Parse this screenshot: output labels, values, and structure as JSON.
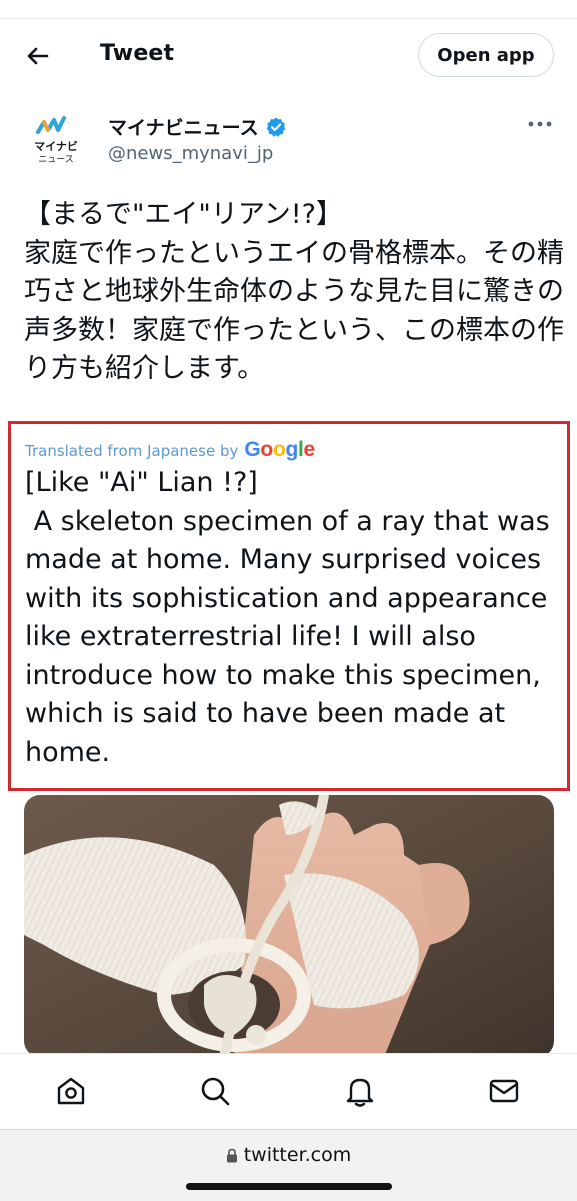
{
  "header": {
    "back_icon": "arrow-left-icon",
    "title": "Tweet",
    "open_app_label": "Open app"
  },
  "author": {
    "avatar_text_top": "マイナビ",
    "avatar_text_bottom": "ニュース",
    "name": "マイナビニュース",
    "verified_icon": "verified-badge-icon",
    "handle": "@news_mynavi_jp",
    "more_icon": "more-horizontal-icon"
  },
  "tweet": {
    "text": "【まるで\"エイ\"リアン!?】\n家庭で作ったというエイの骨格標本。その精巧さと地球外生命体のような見た目に驚きの声多数！家庭で作ったという、この標本の作り方も紹介します。"
  },
  "translation": {
    "label": "Translated from Japanese by",
    "provider": "Google",
    "text": "[Like \"Ai\" Lian !?]\n A skeleton specimen of a ray that was made at home. Many surprised voices with its sophistication and appearance like extraterrestrial life! I will also introduce how to make this specimen, which is said to have been made at home."
  },
  "media": {
    "image_subject": "ray-skeleton-photo"
  },
  "bottom_nav": {
    "items": [
      "home-icon",
      "search-icon",
      "notifications-bell-icon",
      "messages-mail-icon"
    ]
  },
  "browser": {
    "url": "twitter.com",
    "lock_icon": "lock-icon"
  },
  "colors": {
    "accent_blue": "#1d9bf0",
    "translate_label": "#5b9ad5",
    "highlight_border": "#cf2a30",
    "google_blue": "#4285F4",
    "google_red": "#EA4335",
    "google_yellow": "#FBBC05",
    "google_green": "#34A853"
  }
}
